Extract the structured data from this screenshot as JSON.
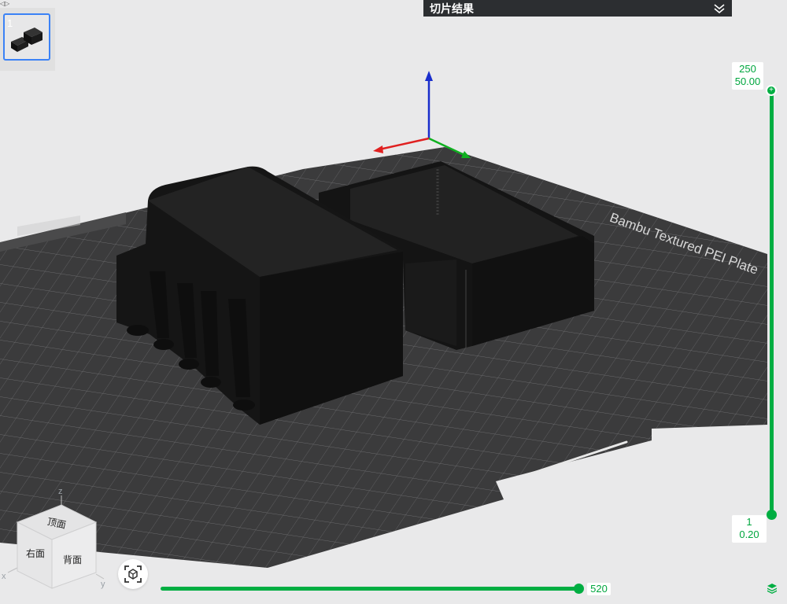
{
  "window": {
    "corner_mark": "◁▷"
  },
  "slice_panel": {
    "title": "切片结果",
    "collapse_icon": "double-chevron-down-icon"
  },
  "plates": [
    {
      "number": "1",
      "selected": true
    }
  ],
  "bed": {
    "label": "Bambu Textured PEI Plate"
  },
  "layer_slider": {
    "top_layer": "250",
    "top_height": "50.00",
    "bottom_layer": "1",
    "bottom_height": "0.20",
    "knob_icon": "plus-icon",
    "layers_icon": "layers-icon"
  },
  "move_slider": {
    "value": "520"
  },
  "view_cube": {
    "top_face": "顶面",
    "left_face": "右面",
    "right_face": "背面",
    "axes": {
      "z": "z",
      "x": "x",
      "y": "y"
    }
  },
  "colors": {
    "accent": "#00ae42",
    "panel_bg": "#2c2e31",
    "selection": "#3b82f6",
    "bed": "#3a3a3b",
    "model": "#151515",
    "axis_x": "#e02020",
    "axis_y": "#10b020",
    "axis_z": "#1a2ecc"
  }
}
